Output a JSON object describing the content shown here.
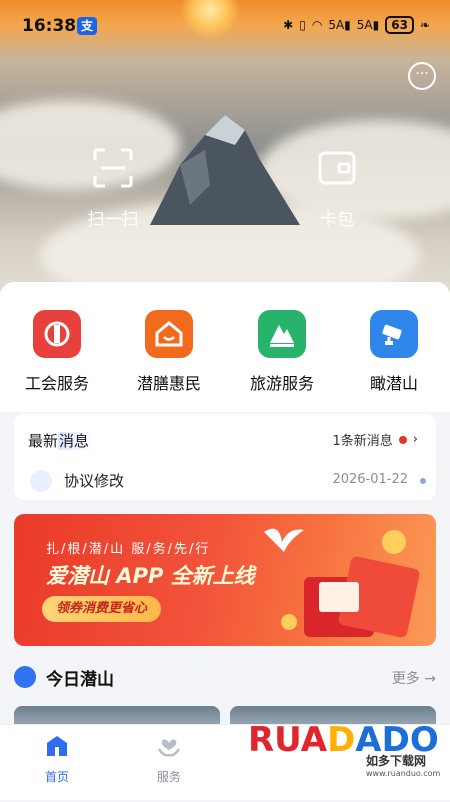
{
  "status_bar": {
    "time": "16:38",
    "app_badge": "支",
    "signal_a": "5A",
    "signal_b": "5A",
    "battery": "63"
  },
  "hero": {
    "actions": [
      {
        "label": "扫一扫",
        "icon": "scan-icon"
      },
      {
        "label": "卡包",
        "icon": "wallet-icon"
      }
    ],
    "chat_icon": "chat-bubble-icon"
  },
  "quick_services": [
    {
      "label": "工会服务",
      "icon": "union-badge-icon",
      "color": "#e8413b"
    },
    {
      "label": "潜膳惠民",
      "icon": "house-smile-icon",
      "color": "#f26a1b"
    },
    {
      "label": "旅游服务",
      "icon": "mountain-icon",
      "color": "#27b46a"
    },
    {
      "label": "瞰潜山",
      "icon": "camera-icon",
      "color": "#2f86ea"
    }
  ],
  "news": {
    "title_prefix": "最新",
    "title_highlight": "消息",
    "count_text": "1条新消息",
    "item": {
      "text": "协议修改",
      "date": "2026-01-22"
    }
  },
  "banner": {
    "slogan": "扎/根/潜/山  服/务/先/行",
    "headline": "爱潜山 APP 全新上线",
    "pill": "领券消费更省心"
  },
  "today_section": {
    "title": "今日潜山",
    "more": "更多 →"
  },
  "tab_bar": [
    {
      "label": "首页",
      "icon": "home-icon",
      "active": true
    },
    {
      "label": "服务",
      "icon": "heart-hands-icon",
      "active": false
    }
  ],
  "watermark": {
    "brand": "RUANDADO",
    "sub": "如多下载网",
    "url": "www.ruanduo.com"
  },
  "colors": {
    "accent": "#2f6cf0",
    "banner_red": "#ea3a28",
    "red_dot": "#e8322c"
  }
}
